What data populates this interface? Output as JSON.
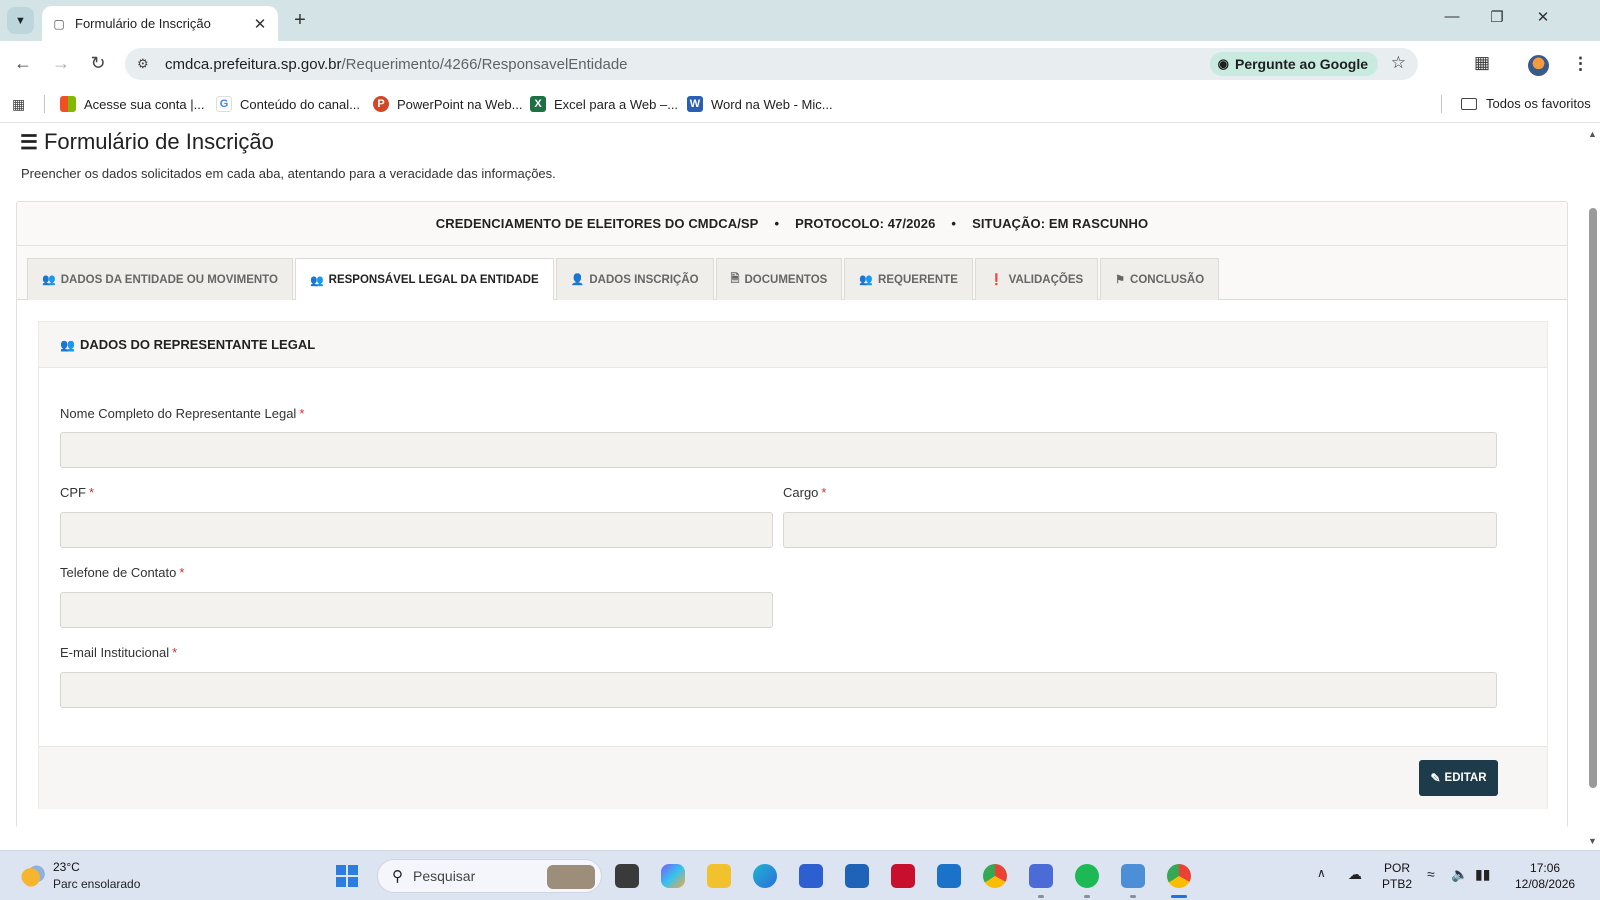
{
  "browser": {
    "tab_title": "Formulário de Inscrição",
    "url_host": "cmdca.prefeitura.sp.gov.br",
    "url_path": "/Requerimento/4266/ResponsavelEntidade",
    "ask_google_label": "Pergunte ao Google",
    "bookmarks": [
      {
        "label": "Acesse sua conta |...",
        "icon": "microsoft-logo-icon"
      },
      {
        "label": "Conteúdo do canal...",
        "icon": "google-logo-icon"
      },
      {
        "label": "PowerPoint na Web...",
        "icon": "powerpoint-icon"
      },
      {
        "label": "Excel para a Web –...",
        "icon": "excel-icon"
      },
      {
        "label": "Word na Web - Mic...",
        "icon": "word-icon"
      }
    ],
    "all_bookmarks_label": "Todos os favoritos"
  },
  "page": {
    "title": "Formulário de Inscrição",
    "subtitle": "Preencher os dados solicitados em cada aba, atentando para a veracidade das informações."
  },
  "card": {
    "program": "CREDENCIAMENTO DE ELEITORES DO CMDCA/SP",
    "protocol": "PROTOCOLO: 47/2026",
    "status": "SITUAÇÃO: EM RASCUNHO",
    "separator": "•"
  },
  "tabs": [
    {
      "label": "DADOS DA ENTIDADE OU MOVIMENTO",
      "icon": "users-icon"
    },
    {
      "label": "RESPONSÁVEL LEGAL DA ENTIDADE",
      "icon": "users-icon",
      "active": true
    },
    {
      "label": "DADOS INSCRIÇÃO",
      "icon": "user-icon"
    },
    {
      "label": "DOCUMENTOS",
      "icon": "file-icon"
    },
    {
      "label": "REQUERENTE",
      "icon": "users-icon"
    },
    {
      "label": "VALIDAÇÕES",
      "icon": "exclamation-icon"
    },
    {
      "label": "CONCLUSÃO",
      "icon": "flag-icon"
    }
  ],
  "section": {
    "title": "DADOS DO REPRESENTANTE LEGAL",
    "fields": {
      "nome": {
        "label": "Nome Completo do Representante Legal",
        "value": ""
      },
      "cpf": {
        "label": "CPF",
        "value": ""
      },
      "cargo": {
        "label": "Cargo",
        "value": ""
      },
      "telefone": {
        "label": "Telefone de Contato",
        "value": ""
      },
      "email": {
        "label": "E-mail Institucional",
        "value": ""
      }
    },
    "required_mark": "*",
    "edit_button": "EDITAR"
  },
  "taskbar": {
    "temperature": "23°C",
    "weather": "Parc ensolarado",
    "search_placeholder": "Pesquisar",
    "lang_top": "POR",
    "lang_bottom": "PTB2",
    "time": "17:06",
    "date": "12/08/2026"
  },
  "colors": {
    "tabstrip": "#d3e3e6",
    "primary_button": "#1d3b4a",
    "required": "#d32f2f",
    "field_bg": "#f4f2ef"
  }
}
